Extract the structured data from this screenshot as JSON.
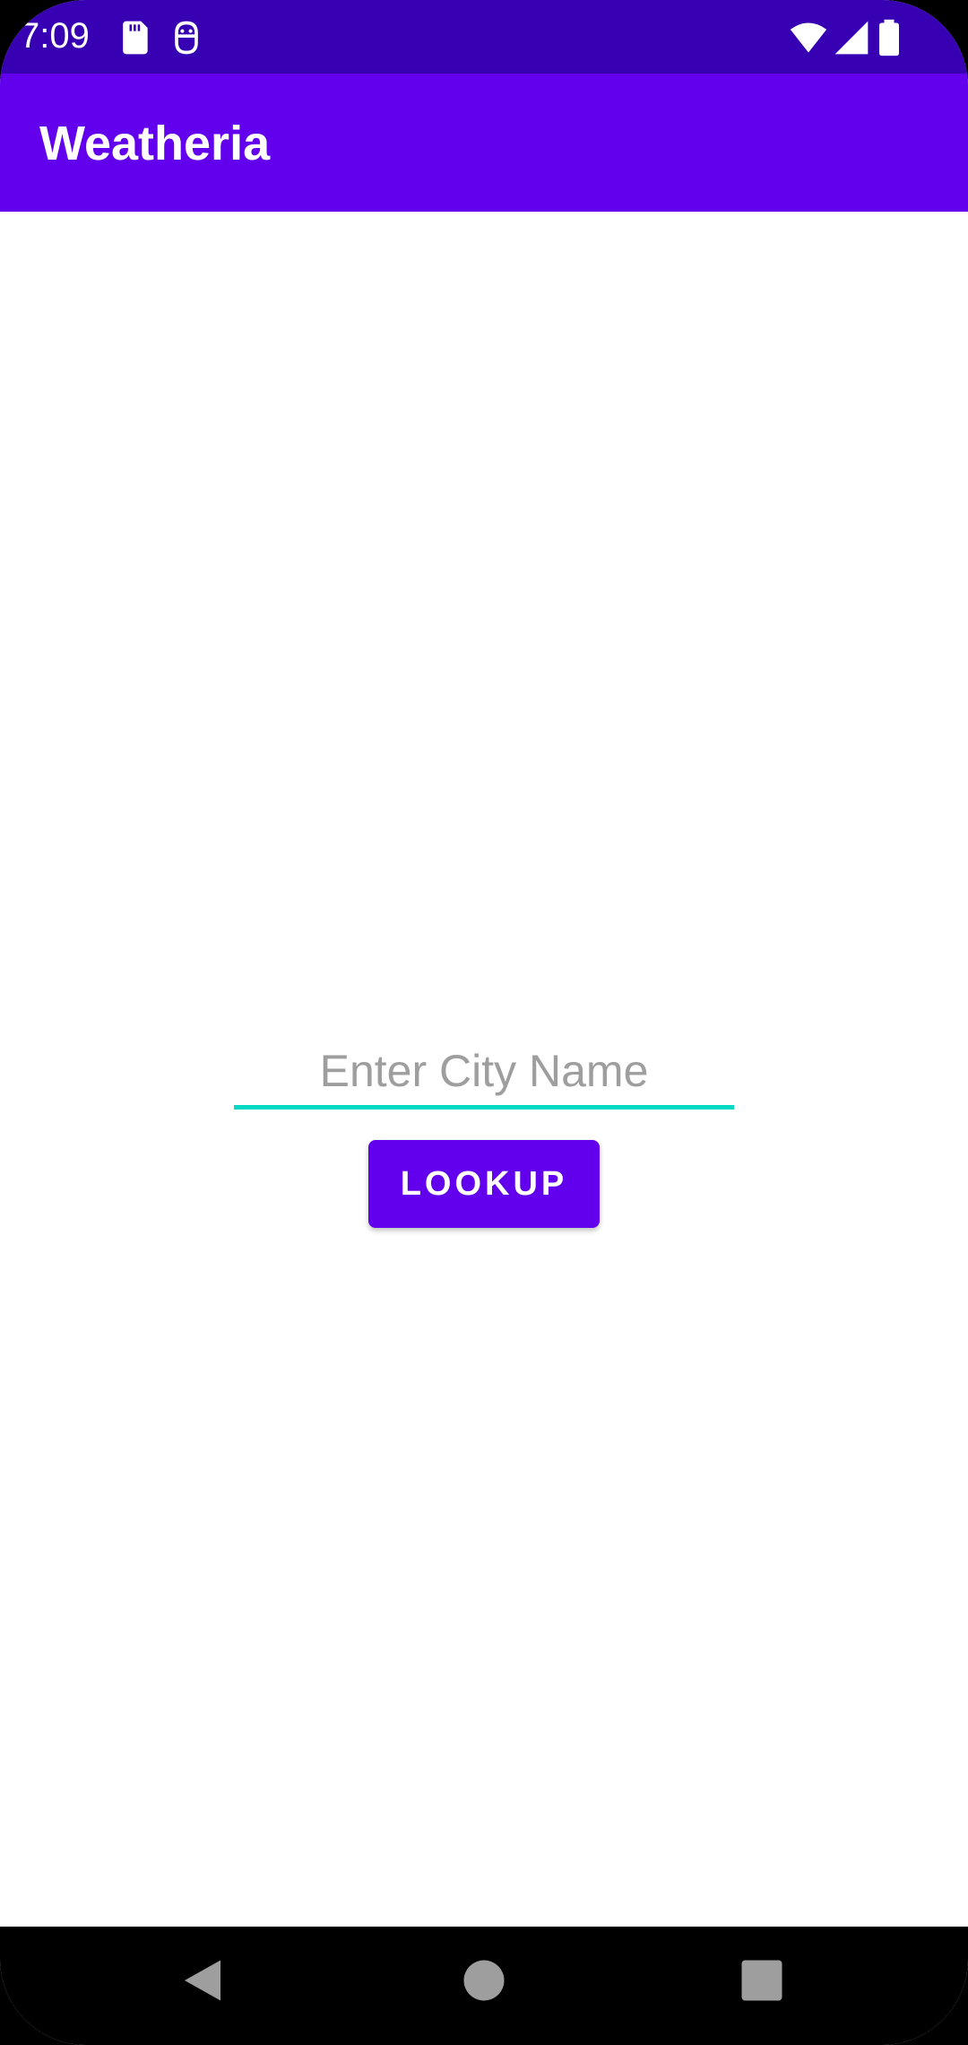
{
  "status_bar": {
    "time": "7:09",
    "icons": [
      "sd-card-icon",
      "face-icon",
      "wifi-icon",
      "signal-icon",
      "battery-icon"
    ],
    "background": "#3700b3"
  },
  "app_bar": {
    "title": "Weatheria",
    "background": "#6200ee"
  },
  "main": {
    "city_input": {
      "value": "",
      "placeholder": "Enter City Name",
      "underline_color": "#03dac5"
    },
    "lookup_button": {
      "label": "LOOKUP",
      "background": "#6200ee"
    }
  },
  "nav_bar": {
    "buttons": [
      "back-icon",
      "home-icon",
      "recents-icon"
    ]
  }
}
